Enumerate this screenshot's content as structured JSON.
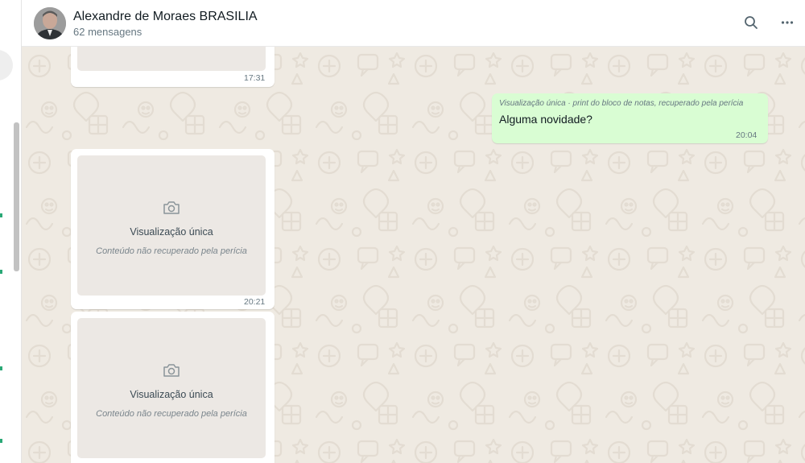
{
  "header": {
    "contact_name": "Alexandre de Moraes BRASILIA",
    "message_count": "62 mensagens"
  },
  "icons": {
    "search": "search-icon",
    "menu": "more-options-icon",
    "camera": "camera-icon"
  },
  "colors": {
    "chat_background": "#efeae2",
    "outgoing_bubble": "#d9fdd3",
    "incoming_bubble": "#ffffff"
  },
  "messages": [
    {
      "direction": "incoming",
      "type": "view-once",
      "time": "17:31"
    },
    {
      "direction": "incoming",
      "type": "view-once",
      "label": "Visualização única",
      "note": "Conteúdo não recuperado pela perícia",
      "time": "20:21"
    },
    {
      "direction": "incoming",
      "type": "view-once",
      "label": "Visualização única",
      "note": "Conteúdo não recuperado pela perícia"
    },
    {
      "direction": "outgoing",
      "type": "text",
      "caption": "Visualização única · print do bloco de notas, recuperado pela perícia",
      "text": "Alguma novidade?",
      "time": "20:04"
    }
  ]
}
